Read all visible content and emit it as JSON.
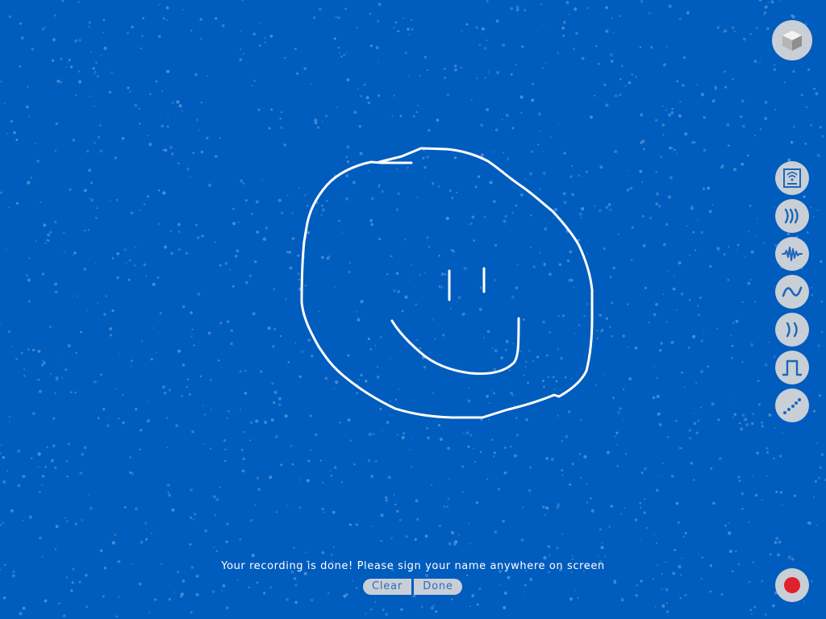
{
  "theme": {
    "background": "#005cbd",
    "dot_color": "#4f8fd6",
    "button_fill": "#c9cfd6",
    "icon_color": "#1d66b8",
    "ink_color": "#ffffff",
    "record_color": "#e0202a",
    "pill_text": "#2a6cbf"
  },
  "prompt": {
    "message": "Your recording is done! Please sign your name anywhere on screen",
    "clear_label": "Clear",
    "done_label": "Done"
  },
  "toolbar": {
    "top_button_icon": "cube-icon",
    "tools": [
      {
        "name": "sensor-box-icon"
      },
      {
        "name": "sound-waves-icon"
      },
      {
        "name": "noise-wave-icon"
      },
      {
        "name": "sine-wave-icon"
      },
      {
        "name": "parentheses-wave-icon"
      },
      {
        "name": "square-wave-icon"
      },
      {
        "name": "dotted-diagonal-icon"
      }
    ],
    "record_icon": "record-icon"
  }
}
